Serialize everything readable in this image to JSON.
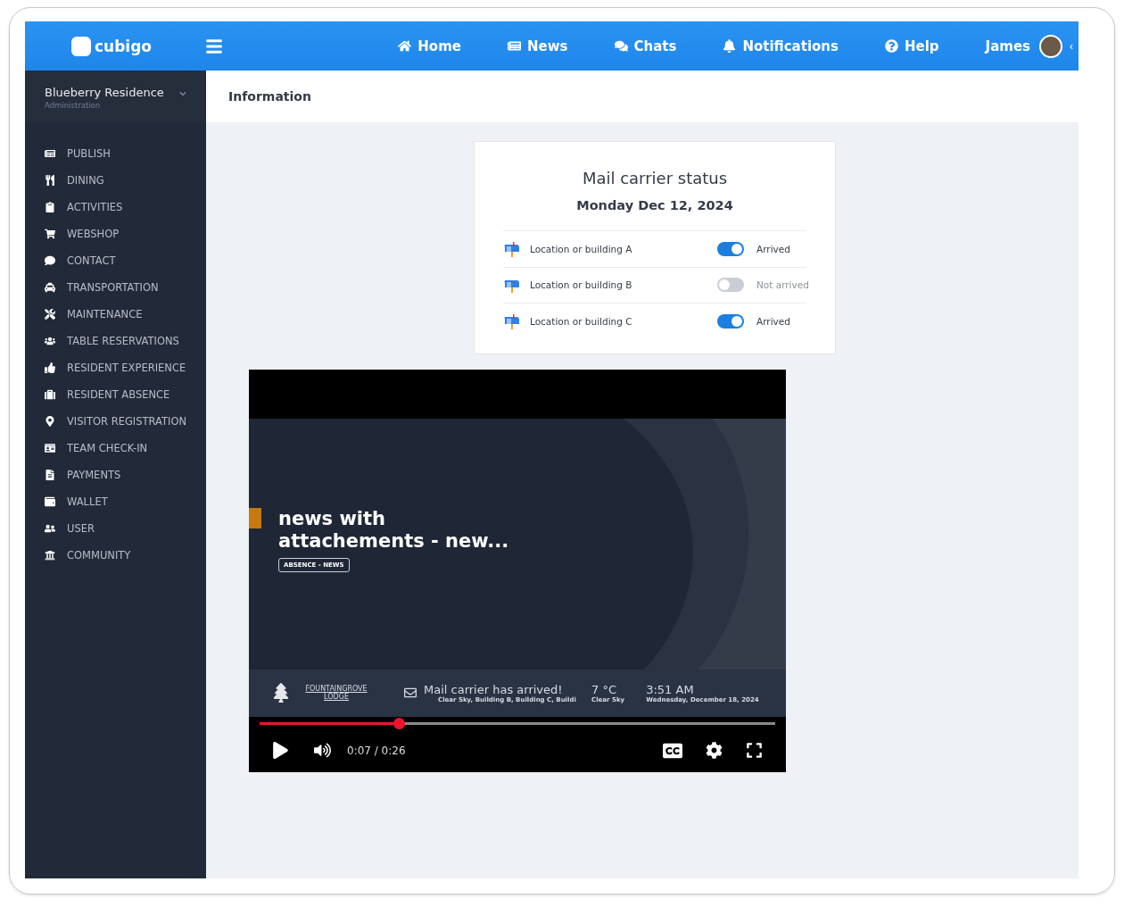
{
  "topbar": {
    "logo": "cubigo",
    "nav": [
      {
        "label": "Home"
      },
      {
        "label": "News"
      },
      {
        "label": "Chats"
      },
      {
        "label": "Notifications"
      },
      {
        "label": "Help"
      }
    ],
    "user": "James",
    "collapse": "‹"
  },
  "sidebar": {
    "residence": "Blueberry Residence",
    "role": "Administration",
    "items": [
      {
        "label": "PUBLISH"
      },
      {
        "label": "DINING"
      },
      {
        "label": "ACTIVITIES"
      },
      {
        "label": "WEBSHOP"
      },
      {
        "label": "CONTACT"
      },
      {
        "label": "TRANSPORTATION"
      },
      {
        "label": "MAINTENANCE"
      },
      {
        "label": "TABLE RESERVATIONS"
      },
      {
        "label": "RESIDENT EXPERIENCE"
      },
      {
        "label": "RESIDENT ABSENCE"
      },
      {
        "label": "VISITOR REGISTRATION"
      },
      {
        "label": "TEAM CHECK-IN"
      },
      {
        "label": "PAYMENTS"
      },
      {
        "label": "WALLET"
      },
      {
        "label": "USER"
      },
      {
        "label": "COMMUNITY"
      }
    ]
  },
  "page": {
    "title": "Information"
  },
  "card": {
    "title": "Mail carrier status",
    "date": "Monday Dec 12, 2024",
    "rows": [
      {
        "location": "Location or building A",
        "on": true,
        "status": "Arrived"
      },
      {
        "location": "Location or building B",
        "on": false,
        "status": "Not arrived"
      },
      {
        "location": "Location or building C",
        "on": true,
        "status": "Arrived"
      }
    ]
  },
  "video": {
    "headline": "news with attachements - new...",
    "tag": "ABSENCE - NEWS",
    "brand_top": "FOUNTAINGROVE",
    "brand_bottom": "LODGE",
    "message": "Mail carrier has arrived!",
    "message_sub": "Clear Sky, Building B, Building C, Buildi",
    "temperature": "7 °C",
    "weather": "Clear Sky",
    "clock": "3:51 AM",
    "clock_date": "Wednesday, December 18, 2024",
    "level": 0.27,
    "time": "0:07 / 0:26"
  }
}
